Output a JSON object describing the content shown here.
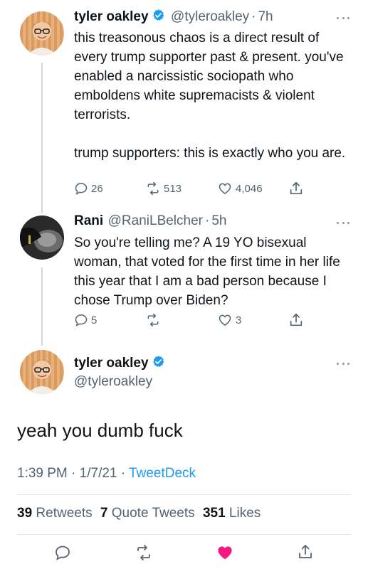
{
  "tweet1": {
    "name": "tyler oakley",
    "handle": "@tyleroakley",
    "sep": "·",
    "time": "7h",
    "text": "this treasonous chaos is a direct result of every trump supporter past & present. you've enabled a narcissistic sociopath who emboldens white supremacists & violent terrorists.\n\ntrump supporters: this is exactly who you are.",
    "replies": "26",
    "retweets": "513",
    "likes": "4,046"
  },
  "tweet2": {
    "name": "Rani",
    "handle": "@RaniLBelcher",
    "sep": "·",
    "time": "5h",
    "text": "So you're telling me? A 19 YO bisexual woman, that voted for the first time in her life this year that I am a bad person because I chose Trump over Biden?",
    "replies": "5",
    "retweets": "",
    "likes": "3"
  },
  "main_tweet": {
    "name": "tyler oakley",
    "handle": "@tyleroakley",
    "text": "yeah you dumb fuck",
    "time": "1:39 PM",
    "date": "1/7/21",
    "sep1": "·",
    "sep2": "·",
    "source": "TweetDeck",
    "retweets_count": "39",
    "retweets_label": "Retweets",
    "quotes_count": "7",
    "quotes_label": "Quote Tweets",
    "likes_count": "351",
    "likes_label": "Likes"
  },
  "colors": {
    "verified": "#1d9bf0",
    "link": "#1d9bf0",
    "liked": "#f91880",
    "muted": "#536471",
    "line": "#cfd9de"
  },
  "icons": [
    "reply-icon",
    "retweet-icon",
    "like-icon",
    "share-icon",
    "verified-badge-icon",
    "more-icon"
  ]
}
